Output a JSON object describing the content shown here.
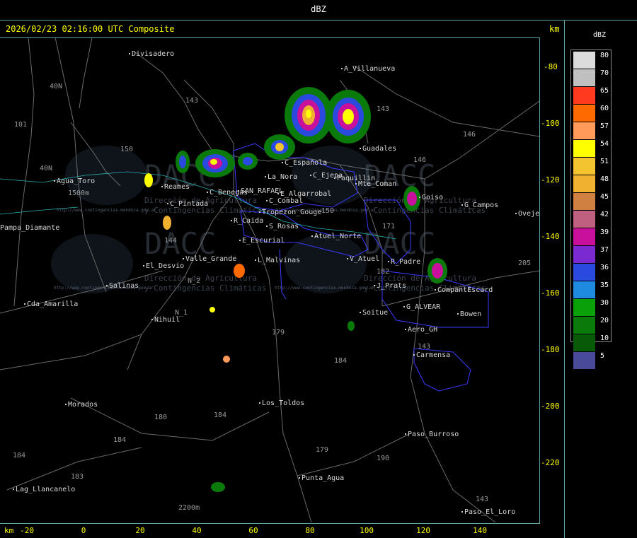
{
  "header": {
    "product": "dBZ",
    "timestamp": "2026/02/23 02:16:00 UTC Composite",
    "unit": "km"
  },
  "legend": {
    "title": "dBZ",
    "levels": [
      {
        "label": "80",
        "color": "#dcdcdc"
      },
      {
        "label": "70",
        "color": "#c0c0c0"
      },
      {
        "label": "65",
        "color": "#ff3a1e"
      },
      {
        "label": "60",
        "color": "#ff6a00"
      },
      {
        "label": "57",
        "color": "#ff9a5a"
      },
      {
        "label": "54",
        "color": "#ffff00"
      },
      {
        "label": "51",
        "color": "#f4c430"
      },
      {
        "label": "48",
        "color": "#f0b030"
      },
      {
        "label": "45",
        "color": "#d08040"
      },
      {
        "label": "42",
        "color": "#c06080"
      },
      {
        "label": "39",
        "color": "#c8109c"
      },
      {
        "label": "37",
        "color": "#7a2ad0"
      },
      {
        "label": "36",
        "color": "#2a4adf"
      },
      {
        "label": "35",
        "color": "#1e8ae0"
      },
      {
        "label": "30",
        "color": "#0aa00a"
      },
      {
        "label": "20",
        "color": "#0a7a0a"
      },
      {
        "label": "10",
        "color": "#085a08"
      },
      {
        "label": "5",
        "color": "#4a4a9a"
      }
    ]
  },
  "axes": {
    "x_unit": "km",
    "x_ticks": [
      "-20",
      "0",
      "20",
      "40",
      "60",
      "80",
      "100",
      "120",
      "140"
    ],
    "y_ticks": [
      "-80",
      "-100",
      "-120",
      "-140",
      "-160",
      "-180",
      "-200",
      "-220"
    ]
  },
  "watermark": {
    "brand": "DACC",
    "line1": "Dirección de Agricultura",
    "line2": "y Contingencias Climáticas",
    "url": "http://www.contingencias.mendoza.gov.ar"
  },
  "places": [
    {
      "name": "Divisadero",
      "x": 186,
      "y": 26
    },
    {
      "name": "A_Villanueva",
      "x": 486,
      "y": 47
    },
    {
      "name": "Guadales",
      "x": 512,
      "y": 160
    },
    {
      "name": "Agua_Toro",
      "x": 80,
      "y": 206
    },
    {
      "name": "Reames",
      "x": 232,
      "y": 214
    },
    {
      "name": "C_Pintada",
      "x": 240,
      "y": 238
    },
    {
      "name": "SAN_RAFAEL",
      "x": 340,
      "y": 220
    },
    {
      "name": "C_Benegas",
      "x": 296,
      "y": 222
    },
    {
      "name": "La_Nora",
      "x": 378,
      "y": 200
    },
    {
      "name": "C_Española",
      "x": 402,
      "y": 180
    },
    {
      "name": "C_Ejepa",
      "x": 442,
      "y": 198
    },
    {
      "name": "Paquillin",
      "x": 476,
      "y": 202
    },
    {
      "name": "Mte_Coman",
      "x": 506,
      "y": 210
    },
    {
      "name": "E_Algarrobal",
      "x": 396,
      "y": 224
    },
    {
      "name": "C_Combal",
      "x": 380,
      "y": 234
    },
    {
      "name": "Tropezon_Gouge",
      "x": 370,
      "y": 250
    },
    {
      "name": "R_Caida",
      "x": 330,
      "y": 262
    },
    {
      "name": "S_Rosas",
      "x": 380,
      "y": 270
    },
    {
      "name": "Atuel_Norte",
      "x": 444,
      "y": 284
    },
    {
      "name": "Goiso",
      "x": 596,
      "y": 229
    },
    {
      "name": "G_Campos",
      "x": 656,
      "y": 240
    },
    {
      "name": "Ovejero",
      "x": 732,
      "y": 252
    },
    {
      "name": "Pampa_Diamante",
      "x": 0,
      "y": 272
    },
    {
      "name": "E_Escurial",
      "x": 342,
      "y": 290
    },
    {
      "name": "Valle_Grande",
      "x": 262,
      "y": 316
    },
    {
      "name": "L_Malvinas",
      "x": 364,
      "y": 318
    },
    {
      "name": "V_Atuel",
      "x": 494,
      "y": 316
    },
    {
      "name": "R_Padre",
      "x": 552,
      "y": 320
    },
    {
      "name": "El_Desvio",
      "x": 206,
      "y": 326
    },
    {
      "name": "Salinas",
      "x": 154,
      "y": 354
    },
    {
      "name": "J_Prats",
      "x": 532,
      "y": 354
    },
    {
      "name": "CompantEscard",
      "x": 618,
      "y": 360
    },
    {
      "name": "Cda_Amarilla",
      "x": 38,
      "y": 380
    },
    {
      "name": "G_ALVEAR",
      "x": 574,
      "y": 384
    },
    {
      "name": "Soitue",
      "x": 512,
      "y": 392
    },
    {
      "name": "Bowen",
      "x": 650,
      "y": 394
    },
    {
      "name": "Nihuil",
      "x": 218,
      "y": 402
    },
    {
      "name": "Aero_GH",
      "x": 576,
      "y": 416
    },
    {
      "name": "Carmensa",
      "x": 588,
      "y": 452
    },
    {
      "name": "Los_Toldos",
      "x": 370,
      "y": 520
    },
    {
      "name": "Morados",
      "x": 96,
      "y": 522
    },
    {
      "name": "Paso_Burroso",
      "x": 576,
      "y": 564
    },
    {
      "name": "Punta_Agua",
      "x": 426,
      "y": 626
    },
    {
      "name": "Lag_Llancanelo",
      "x": 22,
      "y": 642
    },
    {
      "name": "Paso_El_Loro",
      "x": 656,
      "y": 674
    }
  ]
}
